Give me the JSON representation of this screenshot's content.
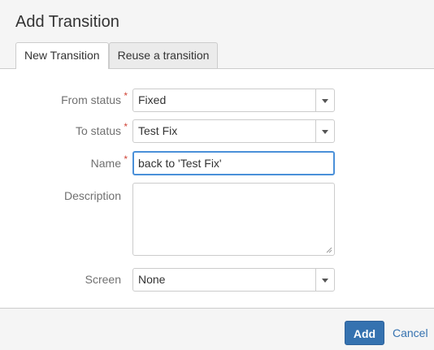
{
  "dialog": {
    "title": "Add Transition"
  },
  "tabs": [
    {
      "label": "New Transition",
      "active": true
    },
    {
      "label": "Reuse a transition",
      "active": false
    }
  ],
  "form": {
    "from_status": {
      "label": "From status",
      "required_mark": "*",
      "value": "Fixed"
    },
    "to_status": {
      "label": "To status",
      "required_mark": "*",
      "value": "Test Fix"
    },
    "name": {
      "label": "Name",
      "required_mark": "*",
      "value": "back to 'Test Fix'"
    },
    "description": {
      "label": "Description",
      "value": ""
    },
    "screen": {
      "label": "Screen",
      "value": "None"
    }
  },
  "footer": {
    "add_label": "Add",
    "cancel_label": "Cancel"
  },
  "colors": {
    "primary": "#3572b0",
    "required": "#d04437",
    "focus_border": "#4a90d9"
  }
}
